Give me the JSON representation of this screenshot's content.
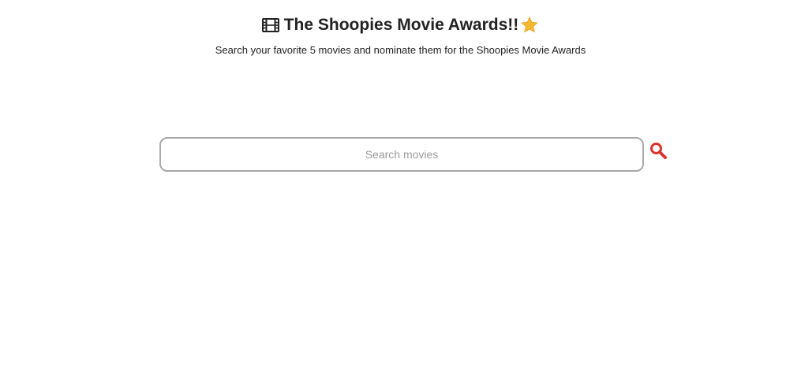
{
  "header": {
    "title": "The Shoopies Movie Awards!!",
    "title_prefix_icon": "film-icon",
    "title_suffix_icon": "star-icon",
    "subtitle": "Search your favorite 5 movies and nominate them for the Shoopies Movie Awards"
  },
  "search": {
    "placeholder": "Search movies",
    "value": "",
    "button_icon": "search-icon"
  },
  "colors": {
    "text": "#222222",
    "accent": "#d9342b",
    "star": "#f5b82e",
    "input_border": "#a8a8a8"
  }
}
